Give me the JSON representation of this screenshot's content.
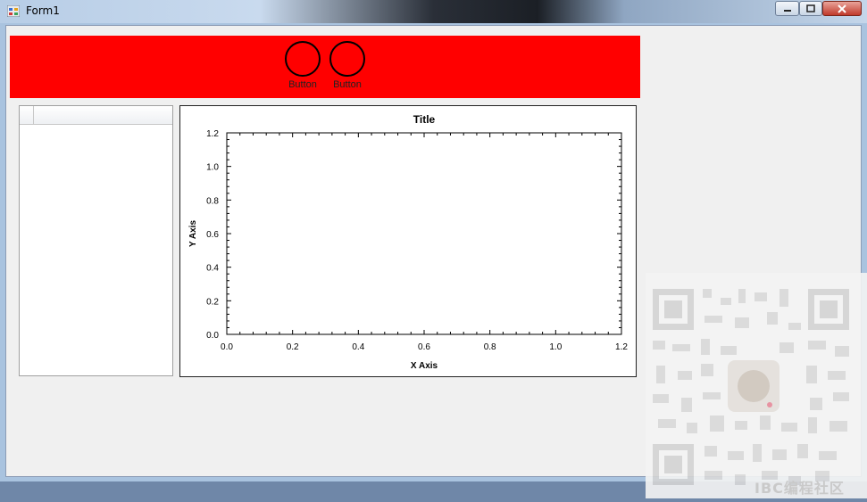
{
  "window": {
    "title": "Form1"
  },
  "toolbar": {
    "buttons": [
      {
        "label": "Button"
      },
      {
        "label": "Button"
      }
    ]
  },
  "chart_data": {
    "type": "line",
    "title": "Title",
    "xlabel": "X Axis",
    "ylabel": "Y Axis",
    "xlim": [
      0.0,
      1.2
    ],
    "ylim": [
      0.0,
      1.2
    ],
    "x_ticks": [
      "0.0",
      "0.2",
      "0.4",
      "0.6",
      "0.8",
      "1.0",
      "1.2"
    ],
    "y_ticks": [
      "0.0",
      "0.2",
      "0.4",
      "0.6",
      "0.8",
      "1.0",
      "1.2"
    ],
    "series": [],
    "grid": false,
    "legend": "none"
  },
  "watermark": {
    "text": "IBC编程社区"
  },
  "colors": {
    "panel": "#ff0000",
    "client": "#f0f0f0"
  }
}
